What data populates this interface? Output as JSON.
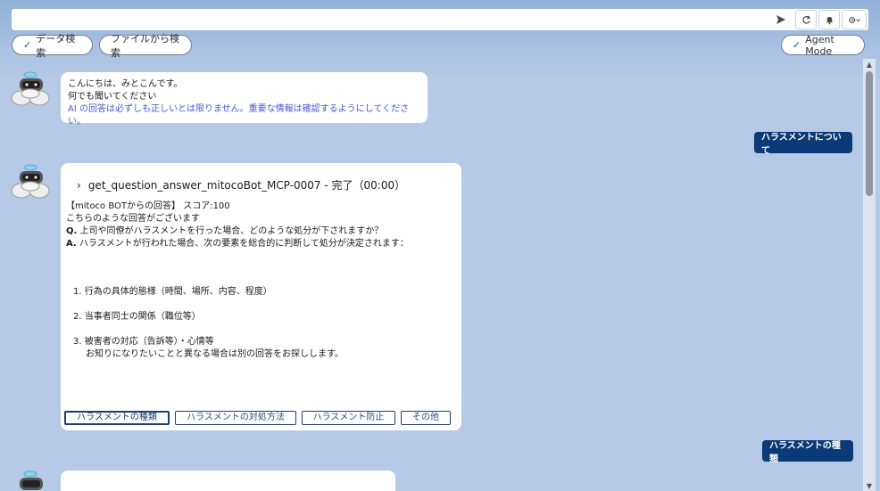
{
  "search": {
    "value": "",
    "placeholder": ""
  },
  "toolbar": {
    "send_icon": "send-icon",
    "refresh_icon": "refresh-icon",
    "bell_icon": "bell-icon",
    "gear_icon": "gear-icon"
  },
  "pills": {
    "data_search": "データ検索",
    "file_search": "ファイルから検索",
    "agent_mode": "Agent Mode",
    "check_mark": "✓"
  },
  "greeting": {
    "line1": "こんにちは、みとこんです。",
    "line2": "何でも聞いてください",
    "disclaimer": "AI の回答は必ずしも正しいとは限りません。重要な情報は確認するようにしてください。"
  },
  "user_messages": {
    "first": "ハラスメントについて",
    "second": "ハラスメントの種類"
  },
  "answer": {
    "tool_chevron": "›",
    "tool_call": "get_question_answer_mitocoBot_MCP-0007 - 完了（00:00）",
    "source": "【mitoco BOTからの回答】 スコア:100",
    "intro": "こちらのような回答がございます",
    "q_label": "Q.",
    "question": " 上司や同僚がハラスメントを行った場合、どのような処分が下されますか？",
    "a_label": "A.",
    "answer_text": " ハラスメントが行われた場合、次の要素を総合的に判断して処分が決定されます：",
    "items": [
      "1. 行為の具体的態様（時間、場所、内容、程度）",
      "2. 当事者同士の関係（職位等）",
      "3. 被害者の対応（告訴等）・心情等"
    ],
    "footer": "お知りになりたいことと異なる場合は別の回答をお探しします。",
    "actions": [
      "ハラスメントの種類",
      "ハラスメントの対処方法",
      "ハラスメント防止",
      "その他"
    ]
  },
  "scrollbar": {
    "up": "▲",
    "down": "▼"
  }
}
